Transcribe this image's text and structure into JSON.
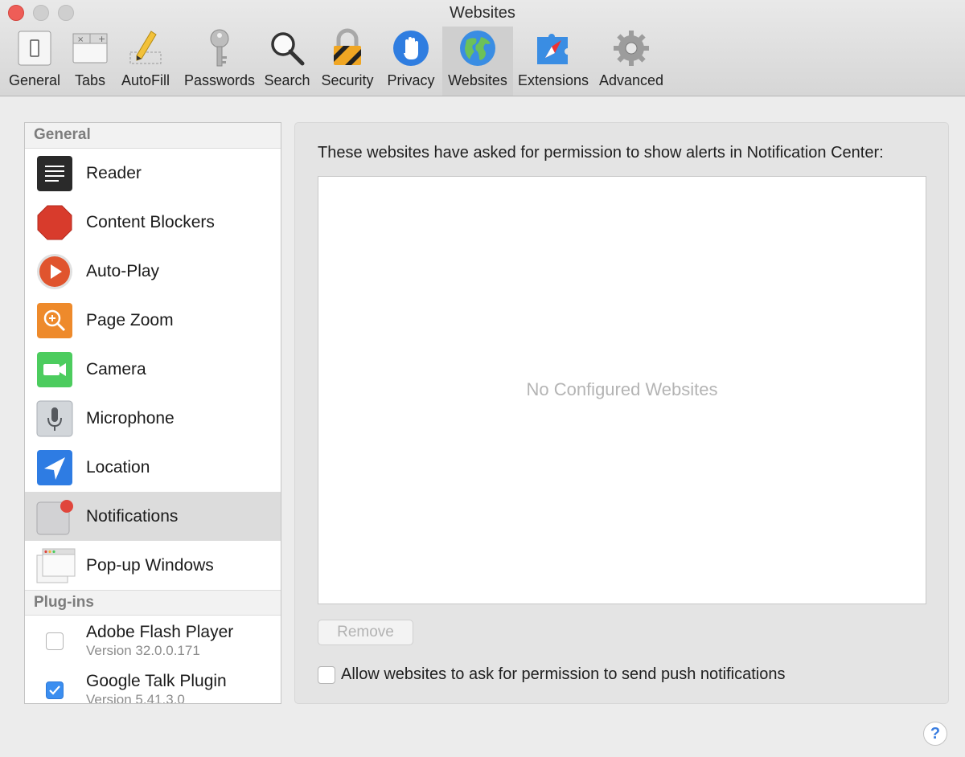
{
  "window": {
    "title": "Websites"
  },
  "toolbar": {
    "items": [
      {
        "label": "General",
        "icon": "switch-icon"
      },
      {
        "label": "Tabs",
        "icon": "tabs-icon"
      },
      {
        "label": "AutoFill",
        "icon": "pencil-icon"
      },
      {
        "label": "Passwords",
        "icon": "key-icon"
      },
      {
        "label": "Search",
        "icon": "magnifier-icon"
      },
      {
        "label": "Security",
        "icon": "padlock-icon"
      },
      {
        "label": "Privacy",
        "icon": "hand-icon"
      },
      {
        "label": "Websites",
        "icon": "globe-icon",
        "selected": true
      },
      {
        "label": "Extensions",
        "icon": "puzzle-compass-icon"
      },
      {
        "label": "Advanced",
        "icon": "gear-icon"
      }
    ]
  },
  "sidebar": {
    "general_header": "General",
    "items": [
      {
        "label": "Reader",
        "icon": "reader-icon"
      },
      {
        "label": "Content Blockers",
        "icon": "stop-sign-icon"
      },
      {
        "label": "Auto-Play",
        "icon": "play-icon"
      },
      {
        "label": "Page Zoom",
        "icon": "zoom-icon"
      },
      {
        "label": "Camera",
        "icon": "camera-icon"
      },
      {
        "label": "Microphone",
        "icon": "microphone-icon"
      },
      {
        "label": "Location",
        "icon": "location-arrow-icon"
      },
      {
        "label": "Notifications",
        "icon": "notification-badge-icon",
        "selected": true
      },
      {
        "label": "Pop-up Windows",
        "icon": "popup-windows-icon"
      }
    ],
    "plugins_header": "Plug-ins",
    "plugins": [
      {
        "name": "Adobe Flash Player",
        "version": "Version 32.0.0.171",
        "enabled": false
      },
      {
        "name": "Google Talk Plugin",
        "version": "Version 5.41.3.0",
        "enabled": true
      }
    ]
  },
  "panel": {
    "heading": "These websites have asked for permission to show alerts in Notification Center:",
    "empty_text": "No Configured Websites",
    "remove_label": "Remove",
    "allow_label": "Allow websites to ask for permission to send push notifications",
    "allow_checked": false
  },
  "help": {
    "label": "?"
  },
  "colors": {
    "accent": "#3b8ef0",
    "close": "#ee5d57",
    "selection": "#dcdcdc"
  }
}
